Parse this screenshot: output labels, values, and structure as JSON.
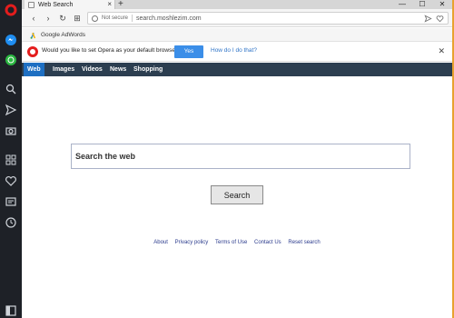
{
  "tab": {
    "title": "Web Search",
    "close": "×",
    "new_tab": "+"
  },
  "window_controls": {
    "minimize": "—",
    "maximize": "☐",
    "close": "✕"
  },
  "nav": {
    "back": "‹",
    "forward": "›",
    "reload": "↻",
    "grid": "⊞"
  },
  "address": {
    "security": "Not secure",
    "url": "search.moshlezim.com"
  },
  "address_icons": [
    "send-icon",
    "heart-icon"
  ],
  "bookmarks": [
    {
      "label": "Google AdWords",
      "icon": "adwords-icon"
    }
  ],
  "prompt": {
    "text": "Would you like to set Opera as your default browser?",
    "yes": "Yes",
    "how": "How do I do that?",
    "close": "✕"
  },
  "pagenav": {
    "items": [
      "Web",
      "Images",
      "Videos",
      "News",
      "Shopping"
    ],
    "active": "Web"
  },
  "search": {
    "placeholder": "Search the web",
    "button": "Search"
  },
  "footer": {
    "links": [
      "About",
      "Privacy policy",
      "Terms of Use",
      "Contact Us",
      "Reset search"
    ]
  },
  "sidebar_icons": [
    "opera-icon",
    "messenger-icon",
    "whatsapp-icon",
    "search-icon",
    "send-icon",
    "camera-icon",
    "speed-dial-icon",
    "heart-icon",
    "news-icon",
    "history-icon",
    "sidebar-toggle-icon"
  ],
  "colors": {
    "accent": "#1e6fc2",
    "prompt_button": "#3b8ee8",
    "opera_red": "#e41d1d",
    "nav_bg": "#2c3e50"
  }
}
